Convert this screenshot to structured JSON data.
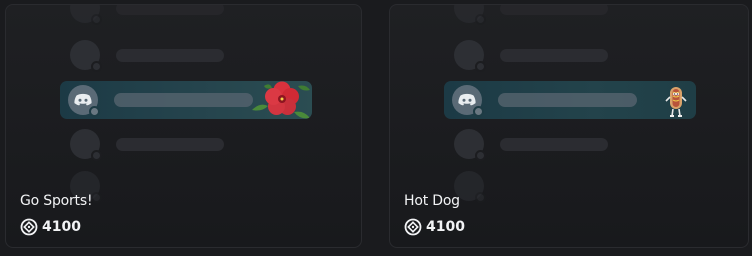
{
  "items": [
    {
      "name": "Go Sports!",
      "price": "4100",
      "icon": "orb-icon",
      "decoration": "hibiscus-flower"
    },
    {
      "name": "Hot Dog",
      "price": "4100",
      "icon": "orb-icon",
      "decoration": "hot-dog-character"
    }
  ],
  "colors": {
    "background": "#1a1b1e",
    "card": "#1f2023",
    "highlight": "#1c3a45",
    "text": "#f2f3f5"
  }
}
